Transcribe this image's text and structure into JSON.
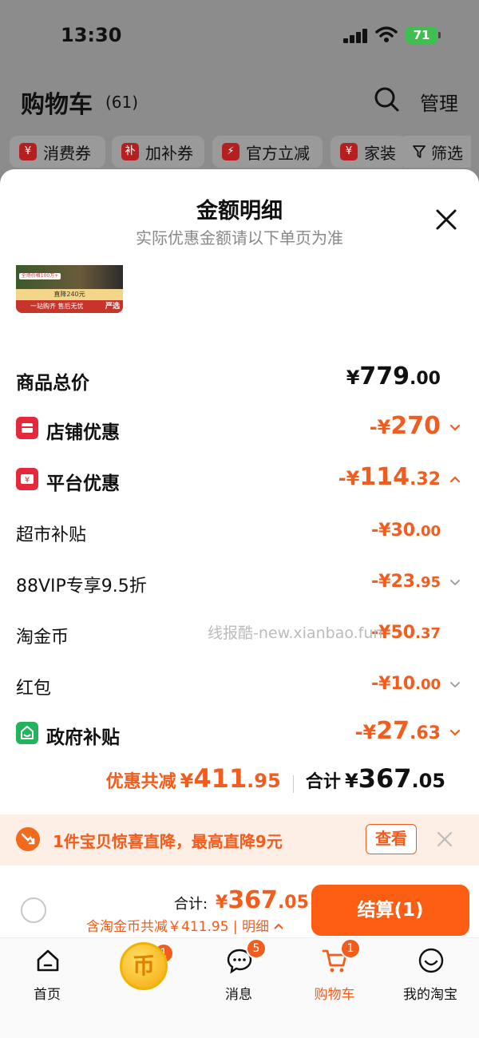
{
  "status": {
    "time": "13:30",
    "battery": "71"
  },
  "header": {
    "title": "购物车",
    "count": "(61)",
    "manage": "管理"
  },
  "chips": [
    {
      "label": "消费券",
      "icon": "¥"
    },
    {
      "label": "加补券",
      "icon": "补"
    },
    {
      "label": "官方立减",
      "icon": "⚡"
    },
    {
      "label": "家装",
      "icon": "¥"
    }
  ],
  "filter_label": "筛选",
  "sheet": {
    "title": "金额明细",
    "subtitle": "实际优惠金额请以下单页为准",
    "thumb": {
      "line1": "全场价格100万+",
      "line2": "直降240元",
      "line3": "一站购齐 售后无忧",
      "badge": "严选"
    }
  },
  "breakdown": {
    "total": {
      "label": "商品总价",
      "yen": "¥",
      "int": "779",
      "dec": ".00"
    },
    "shop": {
      "label": "店铺优惠",
      "yen": "-¥",
      "int": "270",
      "dec": ""
    },
    "platform": {
      "label": "平台优惠",
      "yen": "-¥",
      "int": "114",
      "dec": ".32"
    },
    "items": [
      {
        "label": "超市补贴",
        "yen": "-¥",
        "int": "30",
        "dec": ".00"
      },
      {
        "label": "88VIP专享9.5折",
        "yen": "-¥",
        "int": "23",
        "dec": ".95"
      },
      {
        "label": "淘金币",
        "yen": "-¥",
        "int": "50",
        "dec": ".37"
      },
      {
        "label": "红包",
        "yen": "-¥",
        "int": "10",
        "dec": ".00"
      }
    ],
    "gov": {
      "label": "政府补贴",
      "yen": "-¥",
      "int": "27",
      "dec": ".63"
    }
  },
  "summary": {
    "discount_label": "优惠共减",
    "discount_yen": "¥",
    "discount_int": "411",
    "discount_dec": ".95",
    "total_label": "合计",
    "total_yen": "¥",
    "total_int": "367",
    "total_dec": ".05"
  },
  "watermark": "线报酷-new.xianbao.fun",
  "promo": {
    "text": "1件宝贝惊喜直降，最高直降9元",
    "button": "查看"
  },
  "checkout": {
    "total_label": "合计:",
    "total_yen": "¥",
    "total_int": "367",
    "total_dec": ".05",
    "detail": "含淘金币共减￥411.95 | 明细",
    "button": "结算(1)"
  },
  "tabs": [
    {
      "label": "首页",
      "badge": ""
    },
    {
      "label": "",
      "badge": "1"
    },
    {
      "label": "消息",
      "badge": "5"
    },
    {
      "label": "购物车",
      "badge": "1"
    },
    {
      "label": "我的淘宝",
      "badge": ""
    }
  ],
  "colors": {
    "accent": "#f25c1c",
    "button": "#fb5d12",
    "gov_green": "#22b35c",
    "icon_red": "#e5283a"
  }
}
